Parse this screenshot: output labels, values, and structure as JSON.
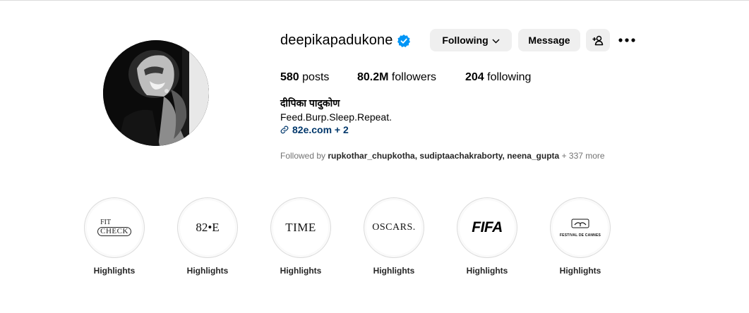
{
  "profile": {
    "username": "deepikapadukone",
    "full_name": "दीपिका पादुकोण",
    "bio": "Feed.Burp.Sleep.Repeat.",
    "link": "82e.com + 2",
    "verified": true
  },
  "buttons": {
    "following": "Following",
    "message": "Message"
  },
  "stats": {
    "posts_count": "580",
    "posts_label": "posts",
    "followers_count": "80.2M",
    "followers_label": "followers",
    "following_count": "204",
    "following_label": "following"
  },
  "followed_by": {
    "prefix": "Followed by",
    "names": "rupkothar_chupkotha, sudiptaachakraborty, neena_gupta",
    "more": "+ 337 more"
  },
  "highlights": [
    {
      "label": "Highlights",
      "logo_l1": "FIT",
      "logo_l2": "CHECK",
      "icon": "fit-check-logo"
    },
    {
      "label": "Highlights",
      "logo": "82•E",
      "icon": "82e-logo"
    },
    {
      "label": "Highlights",
      "logo": "TIME",
      "icon": "time-logo"
    },
    {
      "label": "Highlights",
      "logo": "OSCARS.",
      "icon": "oscars-logo"
    },
    {
      "label": "Highlights",
      "logo": "FIFA",
      "icon": "fifa-logo"
    },
    {
      "label": "Highlights",
      "logo": "FESTIVAL DE CANNES",
      "icon": "cannes-logo"
    }
  ],
  "colors": {
    "verified": "#0095f6",
    "button_bg": "#efefef",
    "link": "#00376b",
    "muted": "#737373",
    "border": "#dbdbdb"
  }
}
